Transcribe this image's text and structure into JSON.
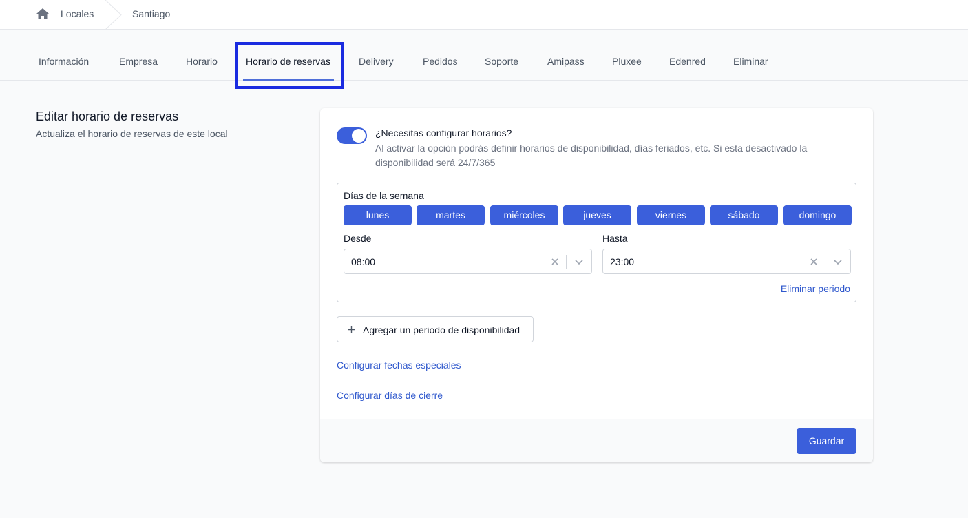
{
  "breadcrumb": {
    "home_icon": "home-icon",
    "items": [
      "Locales",
      "Santiago"
    ]
  },
  "tabs": [
    {
      "label": "Información"
    },
    {
      "label": "Empresa"
    },
    {
      "label": "Horario"
    },
    {
      "label": "Horario de reservas",
      "active": true
    },
    {
      "label": "Delivery"
    },
    {
      "label": "Pedidos"
    },
    {
      "label": "Soporte"
    },
    {
      "label": "Amipass"
    },
    {
      "label": "Pluxee"
    },
    {
      "label": "Edenred"
    },
    {
      "label": "Eliminar"
    }
  ],
  "section": {
    "title": "Editar horario de reservas",
    "subtitle": "Actualiza el horario de reservas de este local"
  },
  "toggle": {
    "on": true,
    "title": "¿Necesitas configurar horarios?",
    "description": "Al activar la opción podrás definir horarios de disponibilidad, días feriados, etc. Si esta desactivado la disponibilidad será 24/7/365"
  },
  "period": {
    "days_label": "Días de la semana",
    "days": [
      "lunes",
      "martes",
      "miércoles",
      "jueves",
      "viernes",
      "sábado",
      "domingo"
    ],
    "from_label": "Desde",
    "from_value": "08:00",
    "to_label": "Hasta",
    "to_value": "23:00",
    "remove_label": "Eliminar periodo"
  },
  "actions": {
    "add_period_label": "Agregar un periodo de disponibilidad",
    "special_dates_link": "Configurar fechas especiales",
    "closing_days_link": "Configurar días de cierre",
    "save_label": "Guardar"
  },
  "colors": {
    "accent": "#3b5fdb",
    "link": "#2f58cd",
    "highlight": "#1a2be0"
  }
}
